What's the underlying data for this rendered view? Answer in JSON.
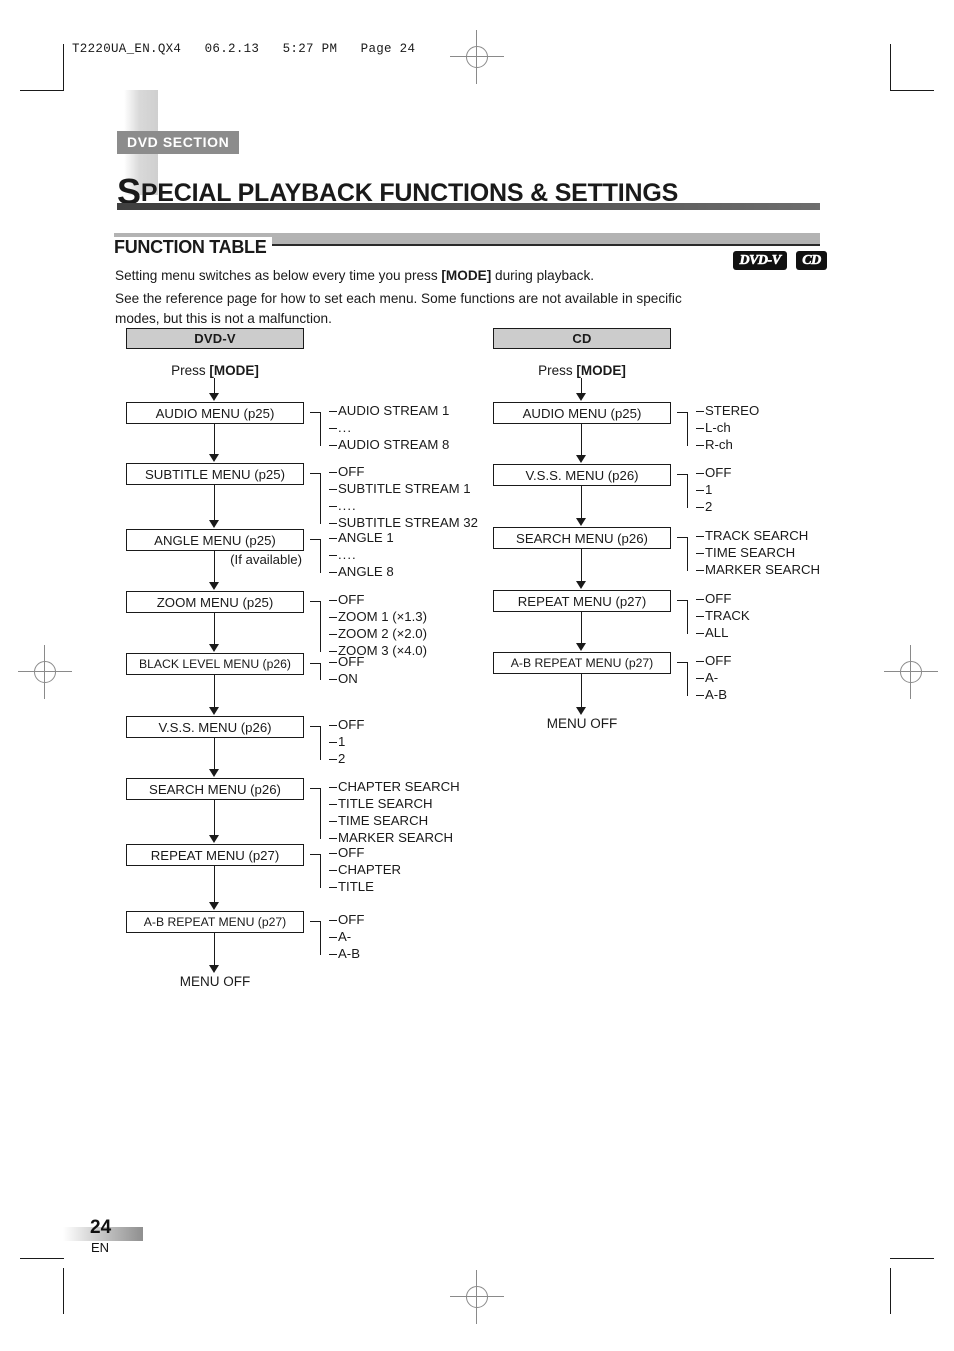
{
  "prepress": {
    "header_line": "T2220UA_EN.QX4   06.2.13   5:27 PM   Page 24"
  },
  "header": {
    "section_tag": "DVD SECTION",
    "title_dropcap": "S",
    "title_rest": "PECIAL PLAYBACK FUNCTIONS & SETTINGS"
  },
  "function_table": {
    "heading": "FUNCTION TABLE",
    "intro_line1_before": "Setting menu switches as below every time you press ",
    "intro_line1_bold": "[MODE]",
    "intro_line1_after": " during playback.",
    "intro_line2": "See the reference page for how to set each menu. Some functions are not available in specific modes, but this is not a malfunction."
  },
  "badges": [
    {
      "label": "DVD-V",
      "name": "dvd-v-badge"
    },
    {
      "label": "CD",
      "name": "cd-badge"
    }
  ],
  "flow": {
    "press_mode_prefix": "Press ",
    "press_mode_key": "[MODE]",
    "menu_off": "MENU OFF",
    "if_available": "(If available)",
    "dvd": {
      "column_title": "DVD-V",
      "nodes": [
        {
          "label": "AUDIO MENU (p25)",
          "options": [
            "AUDIO STREAM 1",
            "...",
            "AUDIO STREAM 8"
          ]
        },
        {
          "label": "SUBTITLE MENU (p25)",
          "options": [
            "OFF",
            "SUBTITLE STREAM 1",
            "....",
            "SUBTITLE STREAM 32"
          ]
        },
        {
          "label": "ANGLE MENU (p25)",
          "options": [
            "ANGLE 1",
            "....",
            "ANGLE 8"
          ]
        },
        {
          "label": "ZOOM MENU (p25)",
          "options": [
            "OFF",
            "ZOOM 1 (×1.3)",
            "ZOOM 2 (×2.0)",
            "ZOOM 3 (×4.0)"
          ]
        },
        {
          "label": "BLACK LEVEL MENU (p26)",
          "options": [
            "OFF",
            "ON"
          ]
        },
        {
          "label": "V.S.S. MENU (p26)",
          "options": [
            "OFF",
            "1",
            "2"
          ]
        },
        {
          "label": "SEARCH MENU (p26)",
          "options": [
            "CHAPTER SEARCH",
            "TITLE SEARCH",
            "TIME SEARCH",
            "MARKER SEARCH"
          ]
        },
        {
          "label": "REPEAT MENU (p27)",
          "options": [
            "OFF",
            "CHAPTER",
            "TITLE"
          ]
        },
        {
          "label": "A-B REPEAT MENU (p27)",
          "options": [
            "OFF",
            "A-",
            "A-B"
          ]
        }
      ]
    },
    "cd": {
      "column_title": "CD",
      "nodes": [
        {
          "label": "AUDIO MENU (p25)",
          "options": [
            "STEREO",
            "L-ch",
            "R-ch"
          ]
        },
        {
          "label": "V.S.S. MENU (p26)",
          "options": [
            "OFF",
            "1",
            "2"
          ]
        },
        {
          "label": "SEARCH MENU (p26)",
          "options": [
            "TRACK SEARCH",
            "TIME SEARCH",
            "MARKER SEARCH"
          ]
        },
        {
          "label": "REPEAT MENU (p27)",
          "options": [
            "OFF",
            "TRACK",
            "ALL"
          ]
        },
        {
          "label": "A-B REPEAT MENU (p27)",
          "options": [
            "OFF",
            "A-",
            "A-B"
          ]
        }
      ]
    }
  },
  "footer": {
    "page_number": "24",
    "language": "EN"
  }
}
